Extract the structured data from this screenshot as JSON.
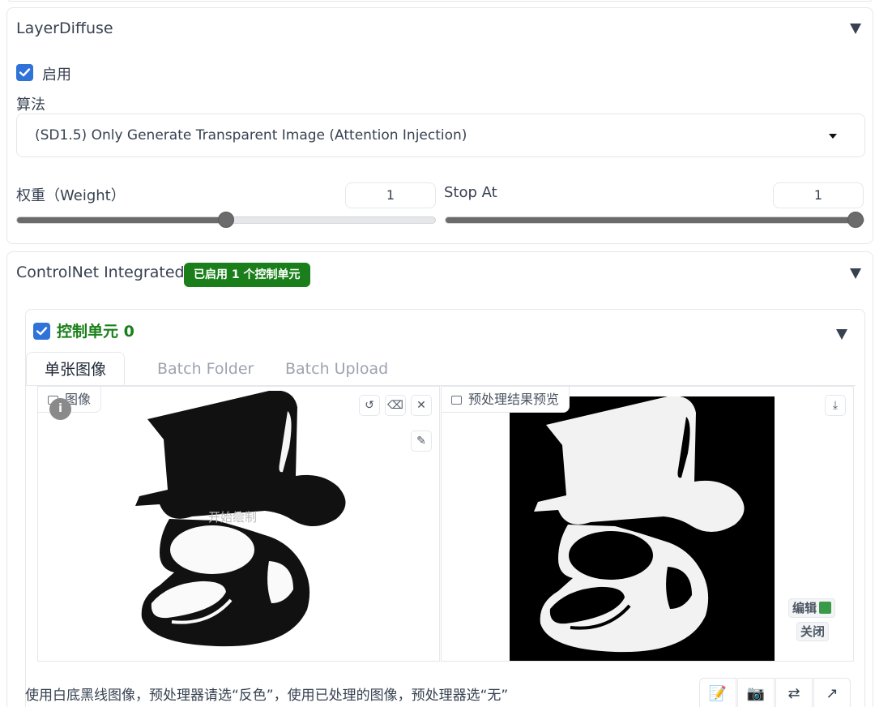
{
  "layer_diffuse": {
    "title": "LayerDiffuse",
    "enable_label": "启用",
    "algorithm_label": "算法",
    "algorithm_value": "(SD1.5) Only Generate Transparent Image (Attention Injection)",
    "weight_label": "权重（Weight）",
    "weight_value": "1",
    "weight_level": 0.5,
    "stop_at_label": "Stop At",
    "stop_at_value": "1",
    "stop_at_level": 1.0
  },
  "controlnet": {
    "title": "ControlNet Integrated",
    "badge": "已启用 1 个控制单元",
    "unit": {
      "title": "控制单元 0",
      "tabs": [
        "单张图像",
        "Batch Folder",
        "Batch Upload"
      ],
      "image_label": "图像",
      "canvas_hint": "开始绘制",
      "preview_label": "预处理结果预览",
      "edit_button": "编辑",
      "close_button": "关闭"
    },
    "hint_text": "使用白底黑线图像，预处理器请选“反色”，使用已处理的图像，预处理器选“无”"
  },
  "colors": {
    "accent_blue": "#2f73d8",
    "badge_green": "#1a7f1a",
    "slider_gray": "#6b6b6b"
  }
}
